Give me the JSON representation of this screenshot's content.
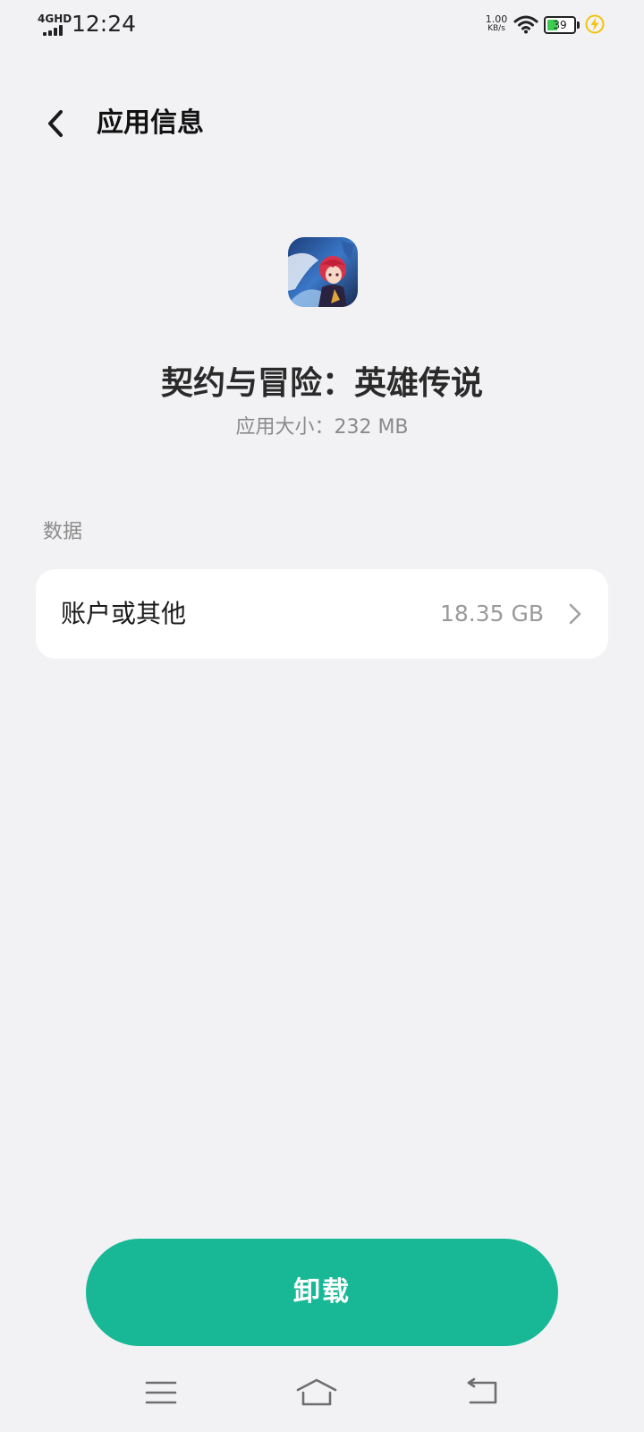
{
  "status_bar": {
    "network": "4GHD",
    "time": "12:24",
    "speed_value": "1.00",
    "speed_unit": "KB/s",
    "battery_level": "39",
    "battery_fraction": 0.39,
    "icons": [
      "signal-icon",
      "wifi-icon",
      "battery-icon",
      "charging-icon"
    ]
  },
  "header": {
    "title": "应用信息",
    "back_icon": "chevron-left-icon"
  },
  "app": {
    "name": "契约与冒险：英雄传说",
    "size_label": "应用大小：",
    "size_value": "232 MB"
  },
  "data_section": {
    "label": "数据",
    "items": [
      {
        "label": "账户或其他",
        "value": "18.35 GB",
        "icon": "chevron-right-icon"
      }
    ]
  },
  "actions": {
    "uninstall_label": "卸载"
  },
  "nav_bar": {
    "icons": [
      "menu-icon",
      "home-icon",
      "back-icon"
    ]
  },
  "colors": {
    "background": "#f2f2f4",
    "card": "#ffffff",
    "accent": "#18b896",
    "secondary_text": "#8a8a8a",
    "battery_fill": "#3ecb52",
    "charge_icon": "#f4c20d"
  }
}
